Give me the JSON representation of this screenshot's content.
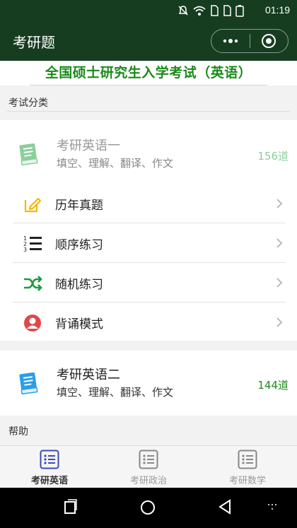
{
  "status_bar": {
    "time": "01:19"
  },
  "navbar": {
    "title": "考研题"
  },
  "banner": {
    "text": "全国硕士研究生入学考试（英语）"
  },
  "section_category": {
    "label": "考试分类"
  },
  "subject1": {
    "name": "考研英语一",
    "desc": "填空、理解、翻译、作文",
    "count": "156道",
    "accent": "#8bcf9b"
  },
  "menu": [
    {
      "label": "历年真题",
      "icon": "edit-icon"
    },
    {
      "label": "顺序练习",
      "icon": "ordered-list-icon"
    },
    {
      "label": "随机练习",
      "icon": "shuffle-icon"
    },
    {
      "label": "背诵模式",
      "icon": "user-icon"
    }
  ],
  "subject2": {
    "name": "考研英语二",
    "desc": "填空、理解、翻译、作文",
    "count": "144道",
    "accent": "#2a9ee6"
  },
  "section_help": {
    "label": "帮助"
  },
  "tabs": [
    {
      "label": "考研英语",
      "active": true
    },
    {
      "label": "考研政治",
      "active": false
    },
    {
      "label": "考研数学",
      "active": false
    }
  ],
  "colors": {
    "brand_dark": "#173d20",
    "banner_green": "#1a8a1a",
    "tab_active": "#3a4bb0",
    "count_green": "#1a8a1a"
  }
}
